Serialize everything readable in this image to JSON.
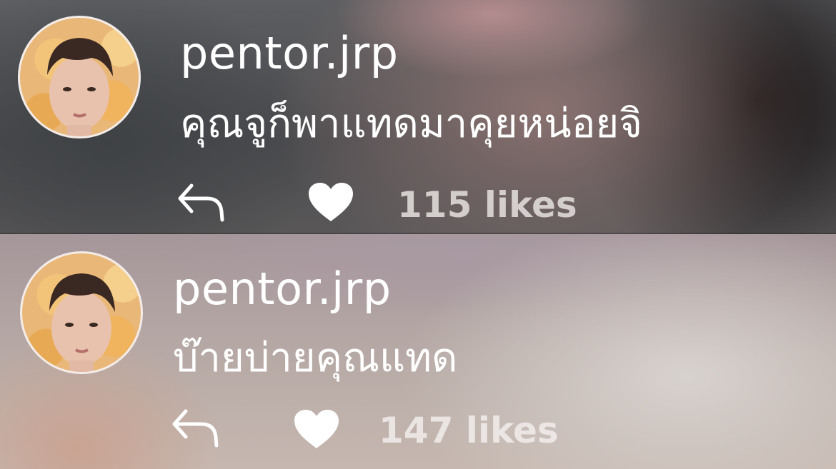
{
  "comments": [
    {
      "username": "pentor.jrp",
      "text": "คุณจูก็พาแทดมาคุยหน่อยจิ",
      "likes_label": "115 likes",
      "avatar": "profile-photo-man-with-flowers",
      "reply_icon": "reply-arrow-icon",
      "like_icon": "heart-icon"
    },
    {
      "username": "pentor.jrp",
      "text": "บ๊ายบ่ายคุณแทด",
      "likes_label": "147 likes",
      "avatar": "profile-photo-man-with-flowers",
      "reply_icon": "reply-arrow-icon",
      "like_icon": "heart-icon"
    }
  ],
  "colors": {
    "text": "#ffffff",
    "likes_text": "#e6e2e0",
    "avatar_border": "#f3ece8"
  }
}
